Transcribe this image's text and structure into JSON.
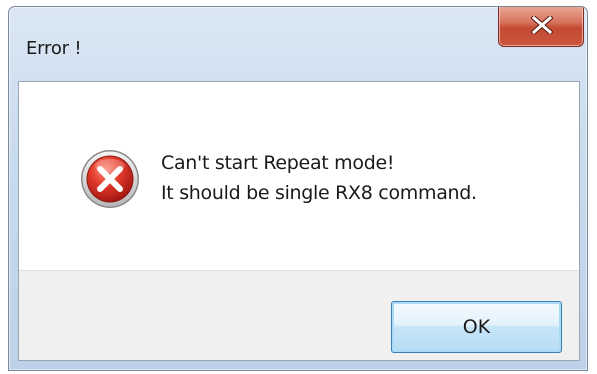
{
  "window": {
    "title": "Error !"
  },
  "close_button": {
    "glyph": "X"
  },
  "message": {
    "line1": "Can't start Repeat mode!",
    "line2": "It should be single RX8 command."
  },
  "icon": "error-icon",
  "ok_button": {
    "label": "OK"
  },
  "colors": {
    "error_red": "#c8281e",
    "close_button_red": "#c44a33",
    "ok_button_border": "#3c7fb1",
    "button_area_bg": "#f0f0f0"
  }
}
